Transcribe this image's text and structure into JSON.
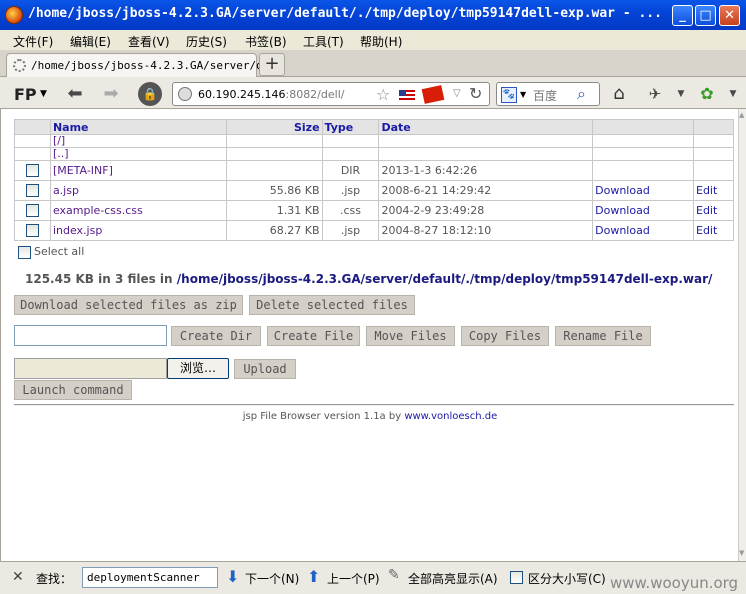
{
  "window": {
    "title": "/home/jboss/jboss-4.2.3.GA/server/default/./tmp/deploy/tmp59147dell-exp.war - ..."
  },
  "menu": [
    "文件(F)",
    "编辑(E)",
    "查看(V)",
    "历史(S)",
    "书签(B)",
    "工具(T)",
    "帮助(H)"
  ],
  "tab": {
    "title": "/home/jboss/jboss-4.2.3.GA/server/d…"
  },
  "nav": {
    "fp_label": "FP",
    "url_host": "60.190.245.146",
    "url_rest": ":8082/dell/",
    "search_placeholder": "百度"
  },
  "table": {
    "headers": {
      "name": "Name",
      "size": "Size",
      "type": "Type",
      "date": "Date"
    },
    "rows": [
      {
        "name": "[/]",
        "size": "",
        "type": "",
        "date": "",
        "download": "",
        "edit": ""
      },
      {
        "name": "[..]",
        "size": "",
        "type": "",
        "date": "",
        "download": "",
        "edit": ""
      },
      {
        "name": "[META-INF]",
        "size": "",
        "type": "DIR",
        "date": "2013-1-3 6:42:26",
        "download": "",
        "edit": ""
      },
      {
        "name": "a.jsp",
        "size": "55.86 KB",
        "type": ".jsp",
        "date": "2008-6-21 14:29:42",
        "download": "Download",
        "edit": "Edit"
      },
      {
        "name": "example-css.css",
        "size": "1.31 KB",
        "type": ".css",
        "date": "2004-2-9 23:49:28",
        "download": "Download",
        "edit": "Edit"
      },
      {
        "name": "index.jsp",
        "size": "68.27 KB",
        "type": ".jsp",
        "date": "2004-8-27 18:12:10",
        "download": "Download",
        "edit": "Edit"
      }
    ]
  },
  "select_all": "Select all",
  "summary": {
    "prefix": "125.45 KB in 3 files in ",
    "path": "/home/jboss/jboss-4.2.3.GA/server/default/./tmp/deploy/tmp59147dell-exp.war/"
  },
  "buttons": {
    "download_zip": "Download selected files as zip",
    "delete": "Delete selected files",
    "create_dir": "Create Dir",
    "create_file": "Create File",
    "move": "Move Files",
    "copy": "Copy Files",
    "rename": "Rename File",
    "browse": "浏览…",
    "upload": "Upload",
    "launch": "Launch command"
  },
  "footer": {
    "text": "jsp File Browser version 1.1a by ",
    "link": "www.vonloesch.de"
  },
  "findbar": {
    "label": "查找：",
    "query": "deploymentScanner",
    "next": "下一个(N)",
    "prev": "上一个(P)",
    "highlight": "全部高亮显示(A)",
    "match_case": "区分大小写(C)"
  },
  "watermark": "www.wooyun.org"
}
